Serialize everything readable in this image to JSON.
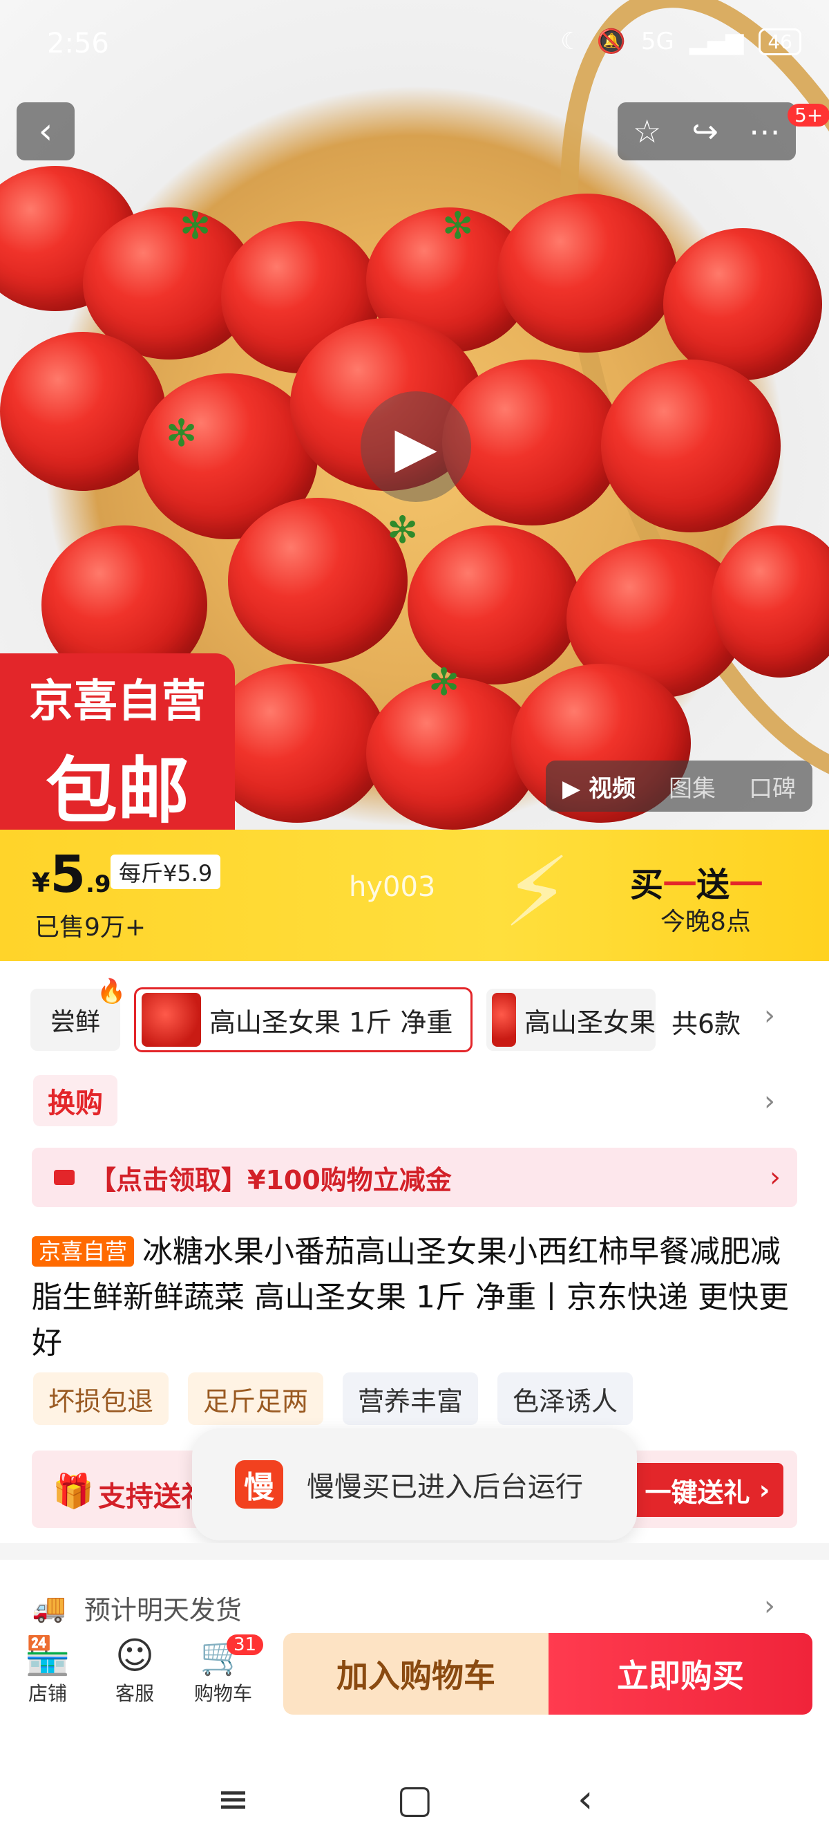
{
  "status_bar": {
    "time": "2:56",
    "battery": "46",
    "network": "5G"
  },
  "hero": {
    "promo_brand": "京喜自营",
    "promo_shipping": "包邮",
    "media_tabs": [
      "视频",
      "图集",
      "口碑"
    ],
    "notification_badge": "5+"
  },
  "price_band": {
    "currency": "¥",
    "price_int": "5",
    "price_dec": ".9",
    "unit_price": "每斤¥5.9",
    "sold": "已售9万+",
    "watermark": "hy003",
    "bogo": [
      "买",
      "一",
      "送",
      "一"
    ],
    "bogo_time": "今晚8点"
  },
  "variants": {
    "partial_label": "尝鲜",
    "selected_label": "高山圣女果 1斤 净重",
    "next_label": "高山圣女果",
    "count": "共6款"
  },
  "swap": {
    "label": "换购"
  },
  "coupon": {
    "text": "【点击领取】¥100购物立减金"
  },
  "product": {
    "tag": "京喜自营",
    "title": "冰糖水果小番茄高山圣女果小西红柿早餐减肥减脂生鲜新鲜蔬菜 高山圣女果 1斤 净重丨京东快递 更快更好"
  },
  "features": [
    "坏损包退",
    "足斤足两",
    "营养丰富",
    "色泽诱人"
  ],
  "gift": {
    "text": "支持送礼",
    "button": "一键送礼"
  },
  "toast": {
    "icon_text": "慢",
    "message": "慢慢买已进入后台运行"
  },
  "shipping": {
    "text": "预计明天发货"
  },
  "bottom_bar": {
    "store": "店铺",
    "service": "客服",
    "cart": "购物车",
    "cart_count": "31",
    "add_to_cart": "加入购物车",
    "buy_now": "立即购买"
  }
}
